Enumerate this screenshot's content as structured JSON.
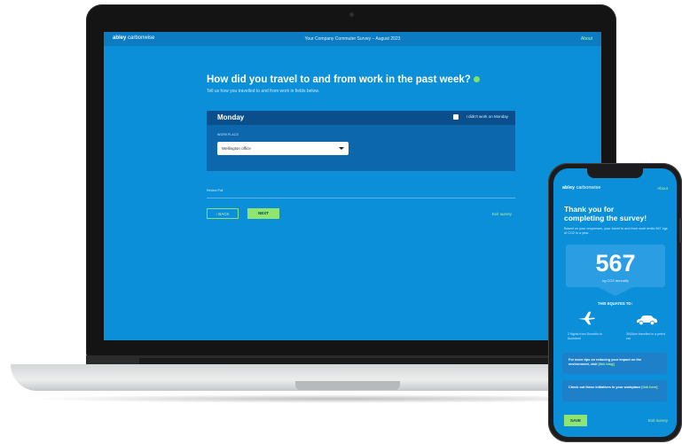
{
  "laptop": {
    "logo_bold": "abley",
    "logo_light": " carbonwise",
    "survey_title": "Your Company Commuter Survey – August 2023",
    "about": "About",
    "question": "How did you travel to and from work in the past week?",
    "subtitle": "Tell us how you travelled to and from work in fields below.",
    "day": "Monday",
    "didnt_work_label": "I didn't work on Monday",
    "workplace_label": "WORKPLACE",
    "workplace_value": "Wellington office",
    "review_label": "Review Poll",
    "back_button": "‹ BACK",
    "next_button": "NEXT",
    "exit_link": "Exit survey"
  },
  "phone": {
    "logo_bold": "abley",
    "logo_light": " carbonwise",
    "about": "About",
    "thanks_line1": "Thank you for",
    "thanks_line2": "completing the survey!",
    "description": "Based on your responses, your travel to and from work emits 567 kgs of CO2 in a year.",
    "number": "567",
    "unit": "kg CO2 annually",
    "equates": "THIS EQUATES TO:",
    "flights": "2 flights from Dunedin to Auckland",
    "km": "3000km travelled in a petrol car",
    "tip1_text": "For more tips on reducing your impact on the environment, visit ",
    "tip1_link": "[link blog]",
    "tip2_text": "Check out these initiatives in your workplace ",
    "tip2_link": "[link here]",
    "save_button": "SAVE",
    "exit_link": "Exit survey"
  },
  "colors": {
    "brand_blue": "#0a8fd8",
    "accent_green": "#8ee56f",
    "dark_panel": "#0a4f8c"
  },
  "icons": [
    "help-icon",
    "checkbox-icon",
    "chevron-down-icon",
    "airplane-icon",
    "car-icon"
  ]
}
